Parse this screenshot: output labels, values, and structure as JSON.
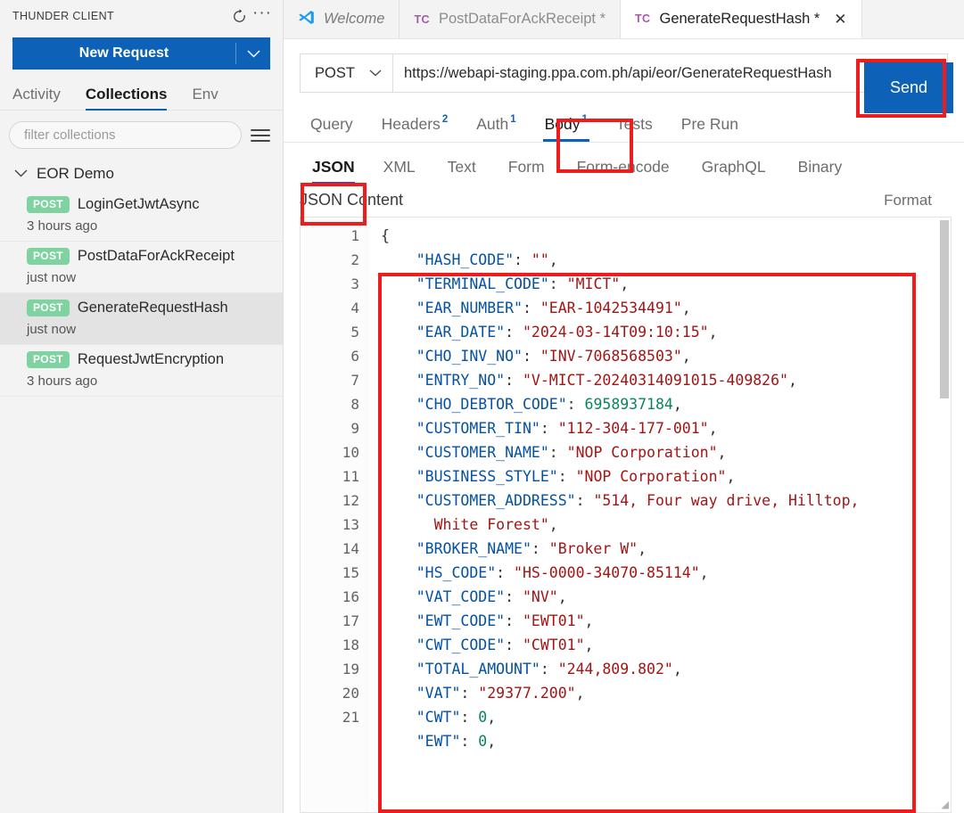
{
  "sidebar": {
    "title": "THUNDER CLIENT",
    "refresh_icon": "refresh-icon",
    "more_icon": "more-icon",
    "new_request_label": "New Request",
    "tabs": [
      {
        "label": "Activity",
        "active": false
      },
      {
        "label": "Collections",
        "active": true
      },
      {
        "label": "Env",
        "active": false
      }
    ],
    "filter_placeholder": "filter collections",
    "menu_icon": "hamburger-icon",
    "collection": {
      "name": "EOR Demo",
      "expanded": true,
      "requests": [
        {
          "method": "POST",
          "name": "LoginGetJwtAsync",
          "time": "3 hours ago",
          "selected": false
        },
        {
          "method": "POST",
          "name": "PostDataForAckReceipt",
          "time": "just now",
          "selected": false
        },
        {
          "method": "POST",
          "name": "GenerateRequestHash",
          "time": "just now",
          "selected": true
        },
        {
          "method": "POST",
          "name": "RequestJwtEncryption",
          "time": "3 hours ago",
          "selected": false
        }
      ]
    }
  },
  "editor_tabs": [
    {
      "icon": "vscode-logo-icon",
      "label": "Welcome",
      "dirty": false,
      "active": false,
      "closable": false
    },
    {
      "icon": "thunder-client-icon",
      "label": "PostDataForAckReceipt *",
      "dirty": true,
      "active": false,
      "closable": false
    },
    {
      "icon": "thunder-client-icon",
      "label": "GenerateRequestHash *",
      "dirty": true,
      "active": true,
      "closable": true
    }
  ],
  "tab_icon_text": "TC",
  "close_glyph": "✕",
  "request": {
    "method": "POST",
    "url": "https://webapi-staging.ppa.com.ph/api/eor/GenerateRequestHash",
    "send_label": "Send"
  },
  "section_tabs": [
    {
      "label": "Query",
      "badge": "",
      "active": false
    },
    {
      "label": "Headers",
      "badge": "2",
      "active": false
    },
    {
      "label": "Auth",
      "badge": "1",
      "active": false
    },
    {
      "label": "Body",
      "badge": "1",
      "active": true
    },
    {
      "label": "Tests",
      "badge": "",
      "active": false
    },
    {
      "label": "Pre Run",
      "badge": "",
      "active": false
    }
  ],
  "body_tabs": [
    {
      "label": "JSON",
      "active": true
    },
    {
      "label": "XML",
      "active": false
    },
    {
      "label": "Text",
      "active": false
    },
    {
      "label": "Form",
      "active": false
    },
    {
      "label": "Form-encode",
      "active": false
    },
    {
      "label": "GraphQL",
      "active": false
    },
    {
      "label": "Binary",
      "active": false
    }
  ],
  "content_header": {
    "title": "JSON Content",
    "action": "Format"
  },
  "json_editor": {
    "line_numbers": [
      1,
      2,
      3,
      4,
      5,
      6,
      7,
      8,
      9,
      10,
      11,
      12,
      13,
      14,
      15,
      16,
      17,
      18,
      19,
      20,
      21
    ],
    "lines": [
      [
        {
          "t": "{",
          "c": "p"
        }
      ],
      [
        {
          "t": "    ",
          "c": "p"
        },
        {
          "t": "\"HASH_CODE\"",
          "c": "k"
        },
        {
          "t": ": ",
          "c": "p"
        },
        {
          "t": "\"\"",
          "c": "s"
        },
        {
          "t": ",",
          "c": "p"
        }
      ],
      [
        {
          "t": "    ",
          "c": "p"
        },
        {
          "t": "\"TERMINAL_CODE\"",
          "c": "k"
        },
        {
          "t": ": ",
          "c": "p"
        },
        {
          "t": "\"MICT\"",
          "c": "s"
        },
        {
          "t": ",",
          "c": "p"
        }
      ],
      [
        {
          "t": "    ",
          "c": "p"
        },
        {
          "t": "\"EAR_NUMBER\"",
          "c": "k"
        },
        {
          "t": ": ",
          "c": "p"
        },
        {
          "t": "\"EAR-1042534491\"",
          "c": "s"
        },
        {
          "t": ",",
          "c": "p"
        }
      ],
      [
        {
          "t": "    ",
          "c": "p"
        },
        {
          "t": "\"EAR_DATE\"",
          "c": "k"
        },
        {
          "t": ": ",
          "c": "p"
        },
        {
          "t": "\"2024-03-14T09:10:15\"",
          "c": "s"
        },
        {
          "t": ",",
          "c": "p"
        }
      ],
      [
        {
          "t": "    ",
          "c": "p"
        },
        {
          "t": "\"CHO_INV_NO\"",
          "c": "k"
        },
        {
          "t": ": ",
          "c": "p"
        },
        {
          "t": "\"INV-7068568503\"",
          "c": "s"
        },
        {
          "t": ",",
          "c": "p"
        }
      ],
      [
        {
          "t": "    ",
          "c": "p"
        },
        {
          "t": "\"ENTRY_NO\"",
          "c": "k"
        },
        {
          "t": ": ",
          "c": "p"
        },
        {
          "t": "\"V-MICT-20240314091015-409826\"",
          "c": "s"
        },
        {
          "t": ",",
          "c": "p"
        }
      ],
      [
        {
          "t": "    ",
          "c": "p"
        },
        {
          "t": "\"CHO_DEBTOR_CODE\"",
          "c": "k"
        },
        {
          "t": ": ",
          "c": "p"
        },
        {
          "t": "6958937184",
          "c": "n"
        },
        {
          "t": ",",
          "c": "p"
        }
      ],
      [
        {
          "t": "    ",
          "c": "p"
        },
        {
          "t": "\"CUSTOMER_TIN\"",
          "c": "k"
        },
        {
          "t": ": ",
          "c": "p"
        },
        {
          "t": "\"112-304-177-001\"",
          "c": "s"
        },
        {
          "t": ",",
          "c": "p"
        }
      ],
      [
        {
          "t": "    ",
          "c": "p"
        },
        {
          "t": "\"CUSTOMER_NAME\"",
          "c": "k"
        },
        {
          "t": ": ",
          "c": "p"
        },
        {
          "t": "\"NOP Corporation\"",
          "c": "s"
        },
        {
          "t": ",",
          "c": "p"
        }
      ],
      [
        {
          "t": "    ",
          "c": "p"
        },
        {
          "t": "\"BUSINESS_STYLE\"",
          "c": "k"
        },
        {
          "t": ": ",
          "c": "p"
        },
        {
          "t": "\"NOP Corporation\"",
          "c": "s"
        },
        {
          "t": ",",
          "c": "p"
        }
      ],
      [
        {
          "t": "    ",
          "c": "p"
        },
        {
          "t": "\"CUSTOMER_ADDRESS\"",
          "c": "k"
        },
        {
          "t": ": ",
          "c": "p"
        },
        {
          "t": "\"514, Four way drive, Hilltop,",
          "c": "s"
        }
      ],
      [
        {
          "t": "      ",
          "c": "p"
        },
        {
          "t": "White Forest\"",
          "c": "s"
        },
        {
          "t": ",",
          "c": "p"
        }
      ],
      [
        {
          "t": "    ",
          "c": "p"
        },
        {
          "t": "\"BROKER_NAME\"",
          "c": "k"
        },
        {
          "t": ": ",
          "c": "p"
        },
        {
          "t": "\"Broker W\"",
          "c": "s"
        },
        {
          "t": ",",
          "c": "p"
        }
      ],
      [
        {
          "t": "    ",
          "c": "p"
        },
        {
          "t": "\"HS_CODE\"",
          "c": "k"
        },
        {
          "t": ": ",
          "c": "p"
        },
        {
          "t": "\"HS-0000-34070-85114\"",
          "c": "s"
        },
        {
          "t": ",",
          "c": "p"
        }
      ],
      [
        {
          "t": "    ",
          "c": "p"
        },
        {
          "t": "\"VAT_CODE\"",
          "c": "k"
        },
        {
          "t": ": ",
          "c": "p"
        },
        {
          "t": "\"NV\"",
          "c": "s"
        },
        {
          "t": ",",
          "c": "p"
        }
      ],
      [
        {
          "t": "    ",
          "c": "p"
        },
        {
          "t": "\"EWT_CODE\"",
          "c": "k"
        },
        {
          "t": ": ",
          "c": "p"
        },
        {
          "t": "\"EWT01\"",
          "c": "s"
        },
        {
          "t": ",",
          "c": "p"
        }
      ],
      [
        {
          "t": "    ",
          "c": "p"
        },
        {
          "t": "\"CWT_CODE\"",
          "c": "k"
        },
        {
          "t": ": ",
          "c": "p"
        },
        {
          "t": "\"CWT01\"",
          "c": "s"
        },
        {
          "t": ",",
          "c": "p"
        }
      ],
      [
        {
          "t": "    ",
          "c": "p"
        },
        {
          "t": "\"TOTAL_AMOUNT\"",
          "c": "k"
        },
        {
          "t": ": ",
          "c": "p"
        },
        {
          "t": "\"244,809.802\"",
          "c": "s"
        },
        {
          "t": ",",
          "c": "p"
        }
      ],
      [
        {
          "t": "    ",
          "c": "p"
        },
        {
          "t": "\"VAT\"",
          "c": "k"
        },
        {
          "t": ": ",
          "c": "p"
        },
        {
          "t": "\"29377.200\"",
          "c": "s"
        },
        {
          "t": ",",
          "c": "p"
        }
      ],
      [
        {
          "t": "    ",
          "c": "p"
        },
        {
          "t": "\"CWT\"",
          "c": "k"
        },
        {
          "t": ": ",
          "c": "p"
        },
        {
          "t": "0",
          "c": "n"
        },
        {
          "t": ",",
          "c": "p"
        }
      ],
      [
        {
          "t": "    ",
          "c": "p"
        },
        {
          "t": "\"EWT\"",
          "c": "k"
        },
        {
          "t": ": ",
          "c": "p"
        },
        {
          "t": "0",
          "c": "n"
        },
        {
          "t": ",",
          "c": "p"
        }
      ]
    ]
  },
  "annotations": [
    {
      "name": "send-button-highlight",
      "color": "#ee1c1c"
    },
    {
      "name": "body-tab-highlight",
      "color": "#ee1c1c"
    },
    {
      "name": "json-tab-highlight",
      "color": "#ee1c1c"
    },
    {
      "name": "json-editor-highlight",
      "color": "#ee1c1c"
    }
  ],
  "colors": {
    "accent": "#0d62b8",
    "method_badge": "#7ed3a0",
    "annotation": "#ee1c1c",
    "json_key": "#0451a5",
    "json_string": "#a31515",
    "json_number": "#098658"
  }
}
